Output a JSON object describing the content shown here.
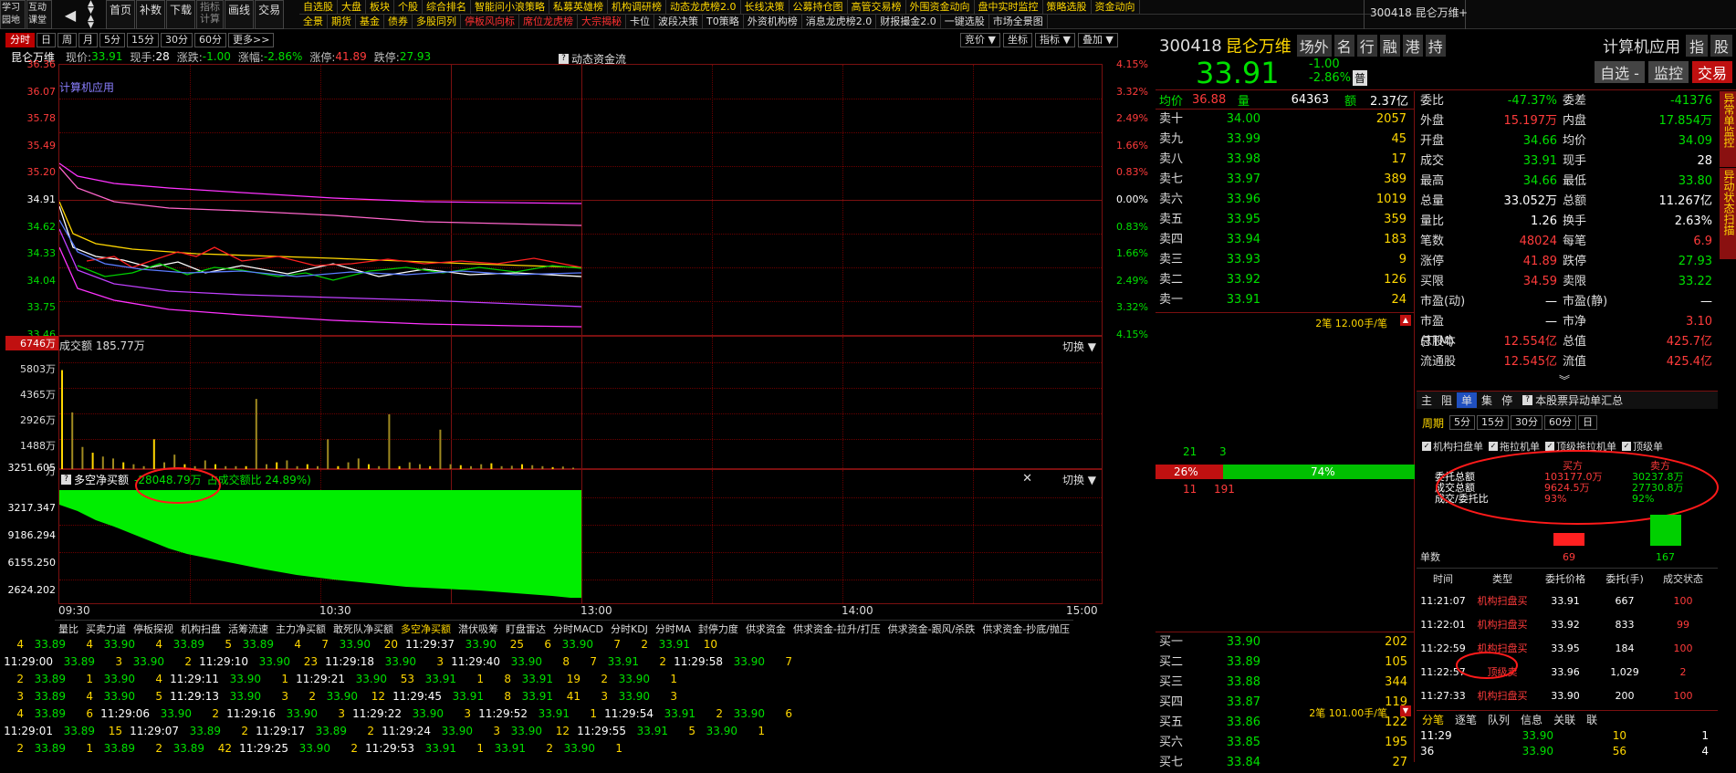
{
  "topbar": {
    "left_buttons": [
      "学习\n园地",
      "互动\n课堂"
    ],
    "nav_buttons": [
      "首页",
      "补数",
      "下载",
      "指标\n计算",
      "画线",
      "交易"
    ],
    "menus_row1": [
      "自选股",
      "大盘",
      "板块",
      "个股",
      "综合排名",
      "智能问小浪策略",
      "私募英雄榜",
      "机构调研榜",
      "动态龙虎榜2.0",
      "长线决策",
      "公募持仓图",
      "高管交易榜",
      "外围资金动向",
      "盘中实时监控",
      "策略选股",
      "资金动向"
    ],
    "menus_row2": [
      "全景",
      "期货",
      "基金",
      "债券",
      "多股同列",
      "停板风向标",
      "席位龙虎榜",
      "大宗揭秘",
      "卡位",
      "波段决策",
      "T0策略",
      "外资机构榜",
      "消息龙虎榜2.0",
      "财报撮金2.0",
      "一键选股",
      "市场全景图"
    ],
    "stock_code_name": "300418 昆仑万维"
  },
  "chart_toolbar": {
    "periods": [
      "分时",
      "日",
      "周",
      "月",
      "5分",
      "15分",
      "30分",
      "60分",
      "更多>>"
    ],
    "right_buttons": [
      "竞价 ▼",
      "坐标",
      "指标 ▼",
      "叠加 ▼"
    ]
  },
  "price_header": {
    "name": "昆仑万维",
    "current_label": "现价:",
    "current": "33.91",
    "hand_label": "现手:",
    "hand": "28",
    "change_label": "涨跌:",
    "change": "-1.00",
    "pct_label": "涨幅:",
    "pct": "-2.86%",
    "up_label": "涨停:",
    "up": "41.89",
    "down_label": "跌停:",
    "down": "27.93",
    "dyn_label": "动态资金流"
  },
  "chart_data": [
    {
      "type": "line",
      "title": "",
      "overlay_label": "计算机应用",
      "yticks_left": [
        "36.36",
        "36.07",
        "35.78",
        "35.49",
        "35.20",
        "34.91",
        "34.62",
        "34.33",
        "34.04",
        "33.75",
        "33.46"
      ],
      "yticks_right": [
        "4.15%",
        "3.32%",
        "2.49%",
        "1.66%",
        "0.83%",
        "0.00%",
        "0.83%",
        "1.66%",
        "2.49%",
        "3.32%",
        "4.15%"
      ],
      "ylim": [
        33.46,
        36.36
      ],
      "x_ticks": [
        "09:30",
        "10:30",
        "13:00",
        "14:00",
        "15:00"
      ],
      "series": [
        {
          "color": "#ffffff",
          "values": [
            34.55,
            34.45,
            34.2,
            34.05,
            34.0,
            33.98,
            33.95,
            33.93,
            33.95,
            33.9,
            33.92,
            33.9,
            33.91
          ]
        },
        {
          "color": "#ffd700",
          "values": [
            34.6,
            34.4,
            34.3,
            34.28,
            34.25,
            34.22,
            34.2,
            34.18,
            34.17,
            34.15,
            34.14,
            34.13,
            34.12
          ]
        }
      ]
    },
    {
      "type": "bar",
      "title": "成交额 185.77万",
      "yticks": [
        "6746万",
        "5803万",
        "4365万",
        "2926万",
        "1488万",
        "万"
      ],
      "ylim": [
        0,
        6746
      ],
      "values": [
        5200,
        3000,
        1200,
        900,
        700,
        600,
        400,
        300,
        200,
        1600,
        400,
        800,
        300,
        200,
        500,
        300,
        200,
        200,
        200,
        3700,
        300,
        400,
        500,
        200,
        300,
        200,
        1600,
        200,
        400,
        600,
        300,
        200,
        2900,
        200,
        400,
        300,
        200,
        2100,
        300,
        250,
        200,
        300,
        350,
        200,
        220,
        300,
        250,
        200,
        150,
        180,
        120
      ]
    },
    {
      "type": "area",
      "title": "多空净买额",
      "value_label": "-28048.79万",
      "ratio_label": "占成交额比 24.89%)",
      "yticks": [
        "3251.605",
        "3217.347",
        "9186.294",
        "6155.250",
        "2624.202"
      ]
    }
  ],
  "time_axis": [
    "09:30",
    "10:30",
    "13:00",
    "14:00",
    "15:00"
  ],
  "switch_label": "切换 ▼",
  "bottom_tabs": [
    "量比",
    "买卖力道",
    "停板探视",
    "机构扫盘",
    "活筹流速",
    "主力净买额",
    "敢死队净买额",
    "多空净买额",
    "潜伏吸筹",
    "盯盘雷达",
    "分时MACD",
    "分时KDJ",
    "分时MA",
    "封停力度",
    "供求资金",
    "供求资金-拉升/打压",
    "供求资金-跟风/杀跌",
    "供求资金-抄底/抛压"
  ],
  "bottom_rows": [
    [
      "4",
      "33.89",
      "4",
      "33.90",
      "4",
      "33.89",
      "5",
      "33.89",
      "4",
      "7",
      "33.90",
      "20",
      "11:29:37",
      "33.90",
      "25",
      "6",
      "33.90",
      "7",
      "2",
      "33.91",
      "10"
    ],
    [
      "11:29:00",
      "33.89",
      "3",
      "33.90",
      "2",
      "11:29:10",
      "33.90",
      "23",
      "11:29:18",
      "33.90",
      "3",
      "11:29:40",
      "33.90",
      "8",
      "7",
      "33.91",
      "2",
      "11:29:58",
      "33.90",
      "7"
    ],
    [
      "2",
      "33.89",
      "1",
      "33.90",
      "4",
      "11:29:11",
      "33.90",
      "1",
      "11:29:21",
      "33.90",
      "53",
      "33.91",
      "1",
      "8",
      "33.91",
      "19",
      "2",
      "33.90",
      "1"
    ],
    [
      "3",
      "33.89",
      "4",
      "33.90",
      "5",
      "11:29:13",
      "33.90",
      "3",
      "2",
      "33.90",
      "12",
      "11:29:45",
      "33.91",
      "8",
      "33.91",
      "41",
      "3",
      "33.90",
      "3"
    ],
    [
      "4",
      "33.89",
      "6",
      "11:29:06",
      "33.90",
      "2",
      "11:29:16",
      "33.90",
      "3",
      "11:29:22",
      "33.90",
      "3",
      "11:29:52",
      "33.91",
      "1",
      "11:29:54",
      "33.91",
      "2",
      "33.90",
      "6"
    ],
    [
      "11:29:01",
      "33.89",
      "15",
      "11:29:07",
      "33.89",
      "2",
      "11:29:17",
      "33.89",
      "2",
      "11:29:24",
      "33.90",
      "3",
      "33.90",
      "12",
      "11:29:55",
      "33.91",
      "5",
      "33.90",
      "1"
    ],
    [
      "2",
      "33.89",
      "1",
      "33.89",
      "2",
      "33.89",
      "42",
      "11:29:25",
      "33.90",
      "2",
      "11:29:53",
      "33.91",
      "1",
      "33.91",
      "2",
      "33.90",
      "1"
    ]
  ],
  "stock_header": {
    "code": "300418",
    "name": "昆仑万维",
    "flags": [
      "场外",
      "名",
      "行",
      "融",
      "港",
      "持"
    ],
    "industry": "计算机应用",
    "ind_btns": [
      "指",
      "股"
    ],
    "price": "33.91",
    "chg": "-1.00",
    "pct": "-2.86%",
    "pu": "普",
    "actions": [
      "自选 -",
      "监控",
      "交易"
    ]
  },
  "avg_row": {
    "l1": "均价",
    "v1": "36.88",
    "l2": "量",
    "v2": "64363",
    "l3": "额",
    "v3": "2.37亿"
  },
  "sell_book": [
    {
      "label": "卖十",
      "price": "34.00",
      "vol": "2057"
    },
    {
      "label": "卖九",
      "price": "33.99",
      "vol": "45"
    },
    {
      "label": "卖八",
      "price": "33.98",
      "vol": "17"
    },
    {
      "label": "卖七",
      "price": "33.97",
      "vol": "389"
    },
    {
      "label": "卖六",
      "price": "33.96",
      "vol": "1019"
    },
    {
      "label": "卖五",
      "price": "33.95",
      "vol": "359"
    },
    {
      "label": "卖四",
      "price": "33.94",
      "vol": "183"
    },
    {
      "label": "卖三",
      "price": "33.93",
      "vol": "9"
    },
    {
      "label": "卖二",
      "price": "33.92",
      "vol": "126"
    },
    {
      "label": "卖一",
      "price": "33.91",
      "vol": "24"
    }
  ],
  "mid_book": {
    "top_note": "2笔 12.00手/笔",
    "n1": "21",
    "n2": "3",
    "pct_l": "26%",
    "pct_r": "74%",
    "n3": "11",
    "n4": "191",
    "bottom_note": "2笔 101.00手/笔",
    "sell_frac": 0.26
  },
  "buy_book": [
    {
      "label": "买一",
      "price": "33.90",
      "vol": "202"
    },
    {
      "label": "买二",
      "price": "33.89",
      "vol": "105"
    },
    {
      "label": "买三",
      "price": "33.88",
      "vol": "344"
    },
    {
      "label": "买四",
      "price": "33.87",
      "vol": "119"
    },
    {
      "label": "买五",
      "price": "33.86",
      "vol": "122"
    },
    {
      "label": "买六",
      "price": "33.85",
      "vol": "195"
    },
    {
      "label": "买七",
      "price": "33.84",
      "vol": "27"
    }
  ],
  "quote": [
    {
      "l1": "委比",
      "v1": "-47.37%",
      "c1": "grn",
      "l2": "委差",
      "v2": "-41376",
      "c2": "grn"
    },
    {
      "l1": "外盘",
      "v1": "15.197万",
      "c1": "red",
      "l2": "内盘",
      "v2": "17.854万",
      "c2": "grn"
    },
    {
      "l1": "开盘",
      "v1": "34.66",
      "c1": "grn",
      "l2": "均价",
      "v2": "34.09",
      "c2": "grn"
    },
    {
      "l1": "成交",
      "v1": "33.91",
      "c1": "grn",
      "l2": "现手",
      "v2": "28",
      "c2": "wht"
    },
    {
      "l1": "最高",
      "v1": "34.66",
      "c1": "grn",
      "l2": "最低",
      "v2": "33.80",
      "c2": "grn"
    },
    {
      "l1": "总量",
      "v1": "33.052万",
      "c1": "wht",
      "l2": "总额",
      "v2": "11.267亿",
      "c2": "wht"
    },
    {
      "l1": "量比",
      "v1": "1.26",
      "c1": "wht",
      "l2": "换手",
      "v2": "2.63%",
      "c2": "wht"
    },
    {
      "l1": "笔数",
      "v1": "48024",
      "c1": "red",
      "l2": "每笔",
      "v2": "6.9",
      "c2": "red"
    },
    {
      "l1": "涨停",
      "v1": "41.89",
      "c1": "red",
      "l2": "跌停",
      "v2": "27.93",
      "c2": "grn"
    },
    {
      "l1": "买限",
      "v1": "34.59",
      "c1": "red",
      "l2": "卖限",
      "v2": "33.22",
      "c2": "grn"
    },
    {
      "l1": "市盈(动)",
      "v1": "—",
      "c1": "wht",
      "l2": "市盈(静)",
      "v2": "—",
      "c2": "wht"
    },
    {
      "l1": "市盈(TTM)",
      "v1": "—",
      "c1": "wht",
      "l2": "市净",
      "v2": "3.10",
      "c2": "red"
    },
    {
      "l1": "总股本",
      "v1": "12.554亿",
      "c1": "red",
      "l2": "总值",
      "v2": "425.7亿",
      "c2": "red"
    },
    {
      "l1": "流通股",
      "v1": "12.545亿",
      "c1": "red",
      "l2": "流值",
      "v2": "425.4亿",
      "c2": "red"
    }
  ],
  "side_tabs": [
    "异常单监控",
    "异动状态扫描"
  ],
  "monitor": {
    "tabs": [
      "主",
      "阻",
      "单",
      "集",
      "停"
    ],
    "summary_link": "本股票异动单汇总",
    "period_label": "周期",
    "periods": [
      "5分",
      "15分",
      "30分",
      "60分",
      "日"
    ],
    "checks": [
      "机构扫盘单",
      "拖拉机单",
      "顶级拖拉机单",
      "顶级单"
    ],
    "head_buy": "买方",
    "head_sell": "卖方",
    "rows": [
      {
        "l": "委托总额",
        "b": "103177.0万",
        "s": "30237.8万"
      },
      {
        "l": "成交总额",
        "b": "9624.5万",
        "s": "27730.8万"
      },
      {
        "l": "成交/委托比",
        "b": "93%",
        "s": "92%"
      }
    ],
    "single_label": "单数",
    "buy_count": "69",
    "sell_count": "167",
    "table_head": [
      "时间",
      "类型",
      "委托价格",
      "委托(手)",
      "成交状态"
    ],
    "table_rows": [
      [
        "11:21:07",
        "机构扫盘买",
        "33.91",
        "667",
        "100"
      ],
      [
        "11:22:01",
        "机构扫盘买",
        "33.92",
        "833",
        "99"
      ],
      [
        "11:22:59",
        "机构扫盘买",
        "33.95",
        "184",
        "100"
      ],
      [
        "11:22:57",
        "顶级卖",
        "33.96",
        "1,029",
        "2"
      ],
      [
        "11:27:33",
        "机构扫盘买",
        "33.90",
        "200",
        "100"
      ]
    ]
  },
  "ticks": {
    "tabs": [
      "分笔",
      "逐笔",
      "队列",
      "信息",
      "关联",
      "联"
    ],
    "rows": [
      [
        "11:29",
        "33.90",
        "10",
        "1"
      ],
      [
        "36",
        "33.90",
        "56",
        "4"
      ]
    ]
  }
}
